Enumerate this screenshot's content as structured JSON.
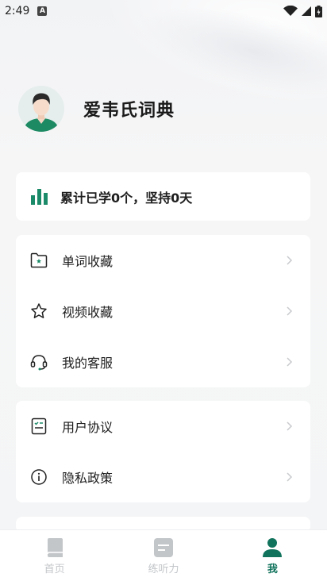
{
  "status_bar": {
    "time": "2:49",
    "notification_glyph": "A"
  },
  "profile": {
    "name": "爱韦氏词典"
  },
  "stats": {
    "text": "累计已学0个，坚持0天"
  },
  "menu_group_1": [
    {
      "label": "单词收藏",
      "icon": "folder-icon"
    },
    {
      "label": "视频收藏",
      "icon": "star-icon"
    },
    {
      "label": "我的客服",
      "icon": "headset-icon"
    }
  ],
  "menu_group_2": [
    {
      "label": "用户协议",
      "icon": "checklist-icon"
    },
    {
      "label": "隐私政策",
      "icon": "info-icon"
    }
  ],
  "bottom_nav": [
    {
      "label": "首页",
      "icon": "book-icon",
      "active": false
    },
    {
      "label": "练听力",
      "icon": "document-icon",
      "active": false
    },
    {
      "label": "我",
      "icon": "person-icon",
      "active": true
    }
  ],
  "colors": {
    "accent": "#11735c",
    "inactive": "#c3c6c9",
    "chevron": "#c8cacd"
  }
}
